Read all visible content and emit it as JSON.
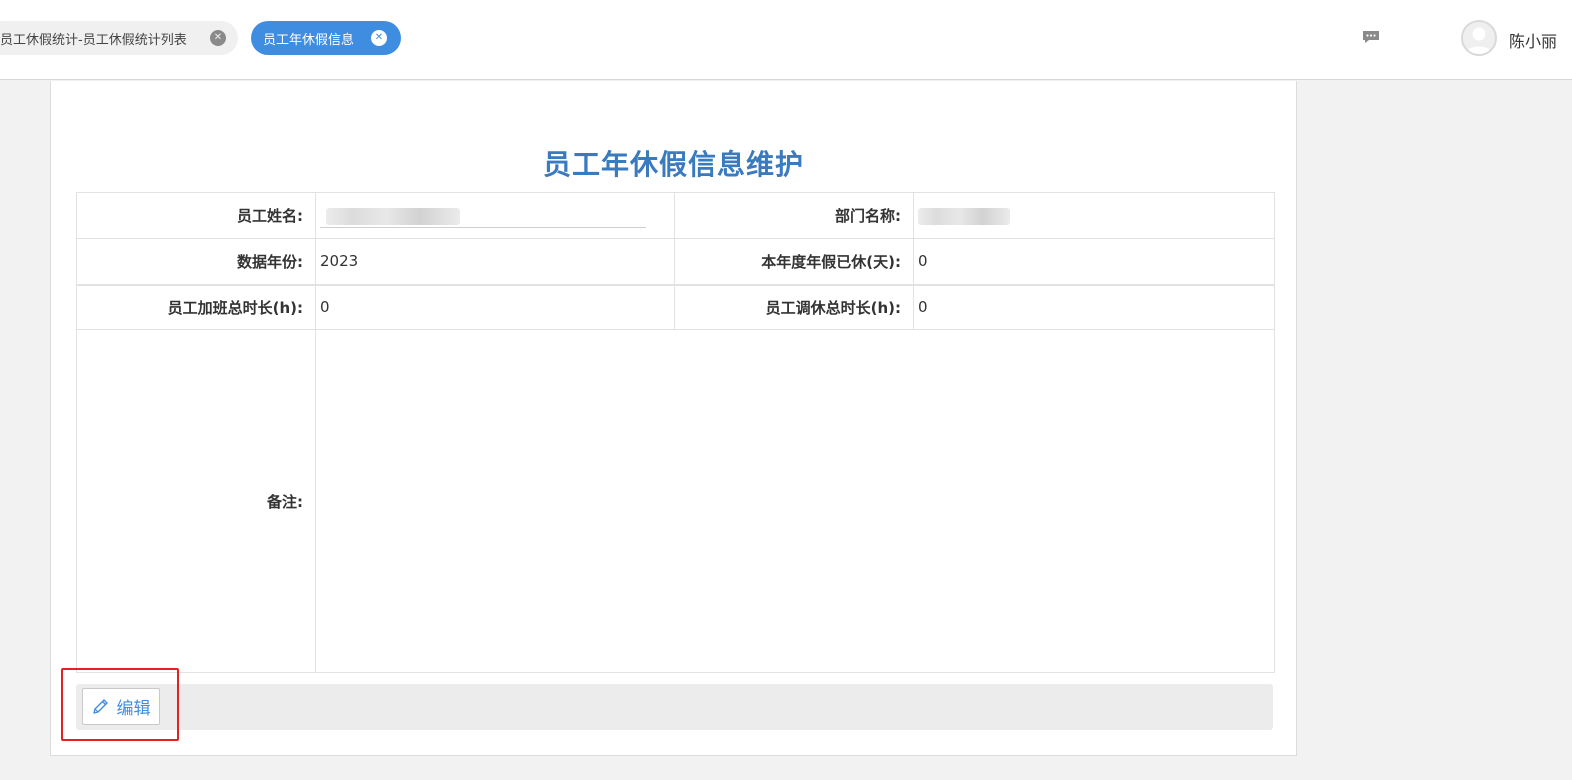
{
  "tabs": [
    {
      "label": "员工休假统计-员工休假统计列表",
      "active": false
    },
    {
      "label": "员工年休假信息",
      "active": true
    }
  ],
  "header": {
    "message_icon": "message-icon",
    "avatar_icon": "user-avatar",
    "username": "陈小丽"
  },
  "form": {
    "title": "员工年休假信息维护",
    "fields": {
      "employee_name_label": "员工姓名:",
      "department_label": "部门名称:",
      "data_year_label": "数据年份:",
      "data_year_value": "2023",
      "leave_taken_label": "本年度年假已休(天):",
      "leave_taken_value": "0",
      "overtime_label": "员工加班总时长(h):",
      "overtime_value": "0",
      "comp_time_label": "员工调休总时长(h):",
      "comp_time_value": "0",
      "remarks_label": "备注:"
    }
  },
  "actions": {
    "edit_label": "编辑",
    "edit_icon": "pencil-icon"
  },
  "colors": {
    "accent": "#3f8de1",
    "title": "#3a7abf",
    "highlight": "#e62020"
  }
}
